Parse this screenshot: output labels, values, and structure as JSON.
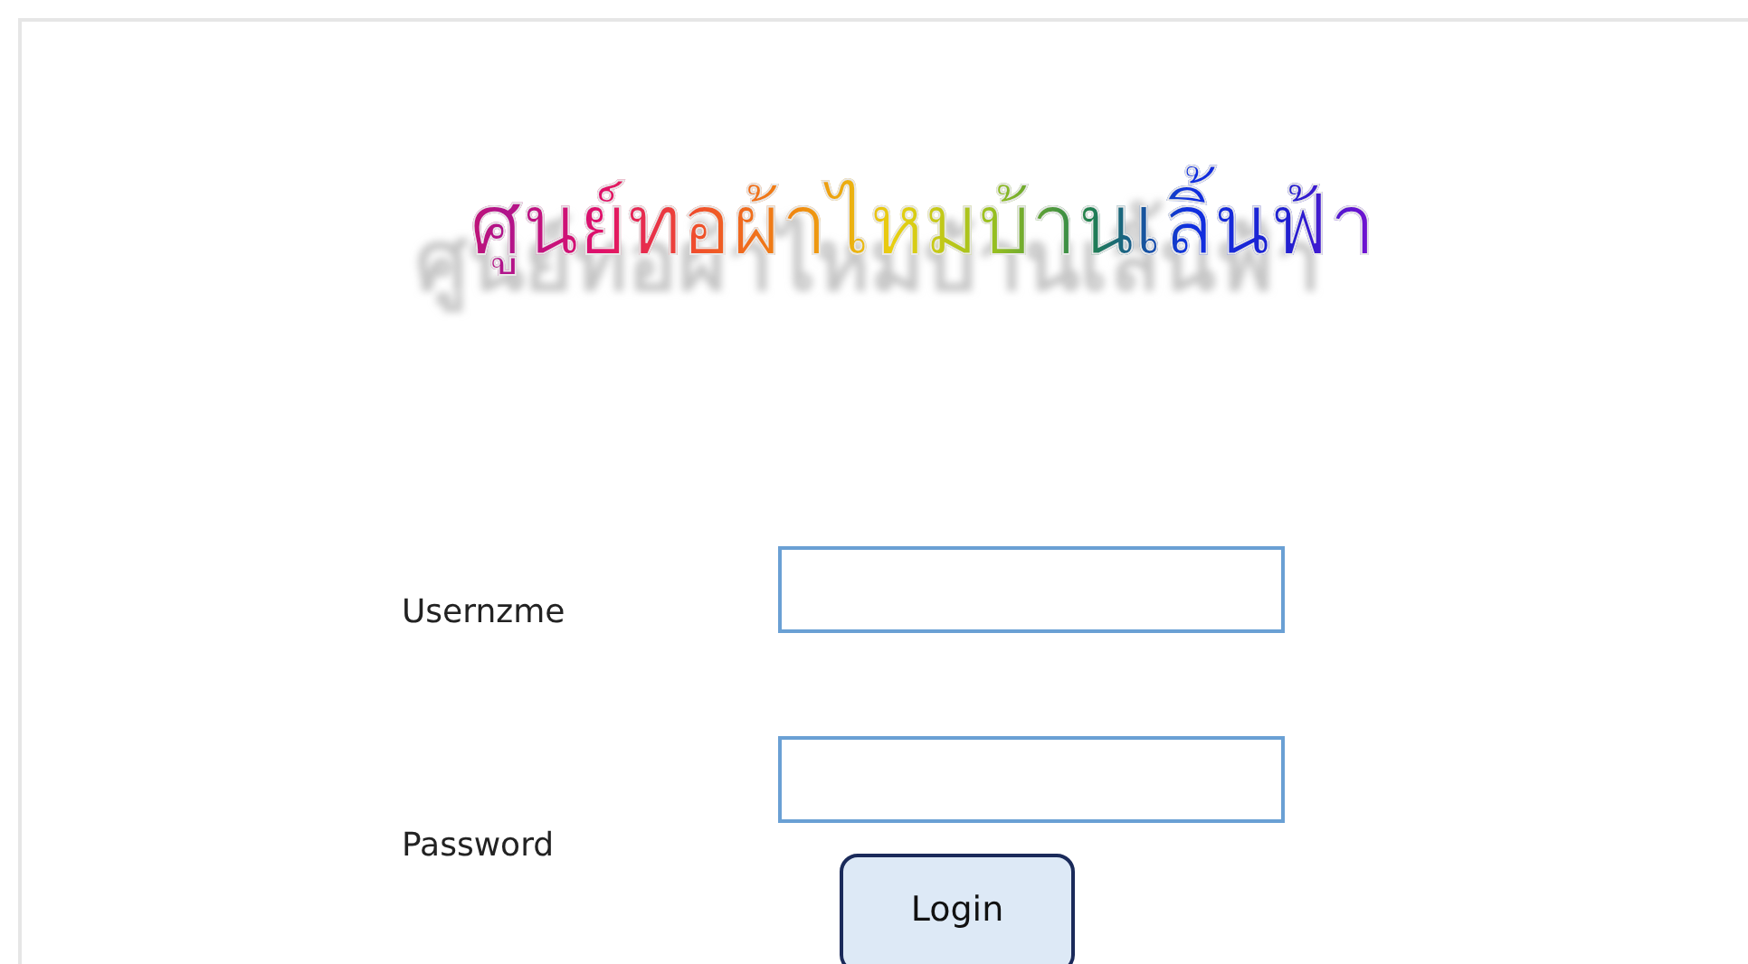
{
  "title": "ศูนย์ทอผ้าไหมบ้านเลิ้นฟ้า",
  "fields": [
    {
      "label": "Usernzme"
    },
    {
      "label": "Password"
    }
  ],
  "login_button": "Login"
}
